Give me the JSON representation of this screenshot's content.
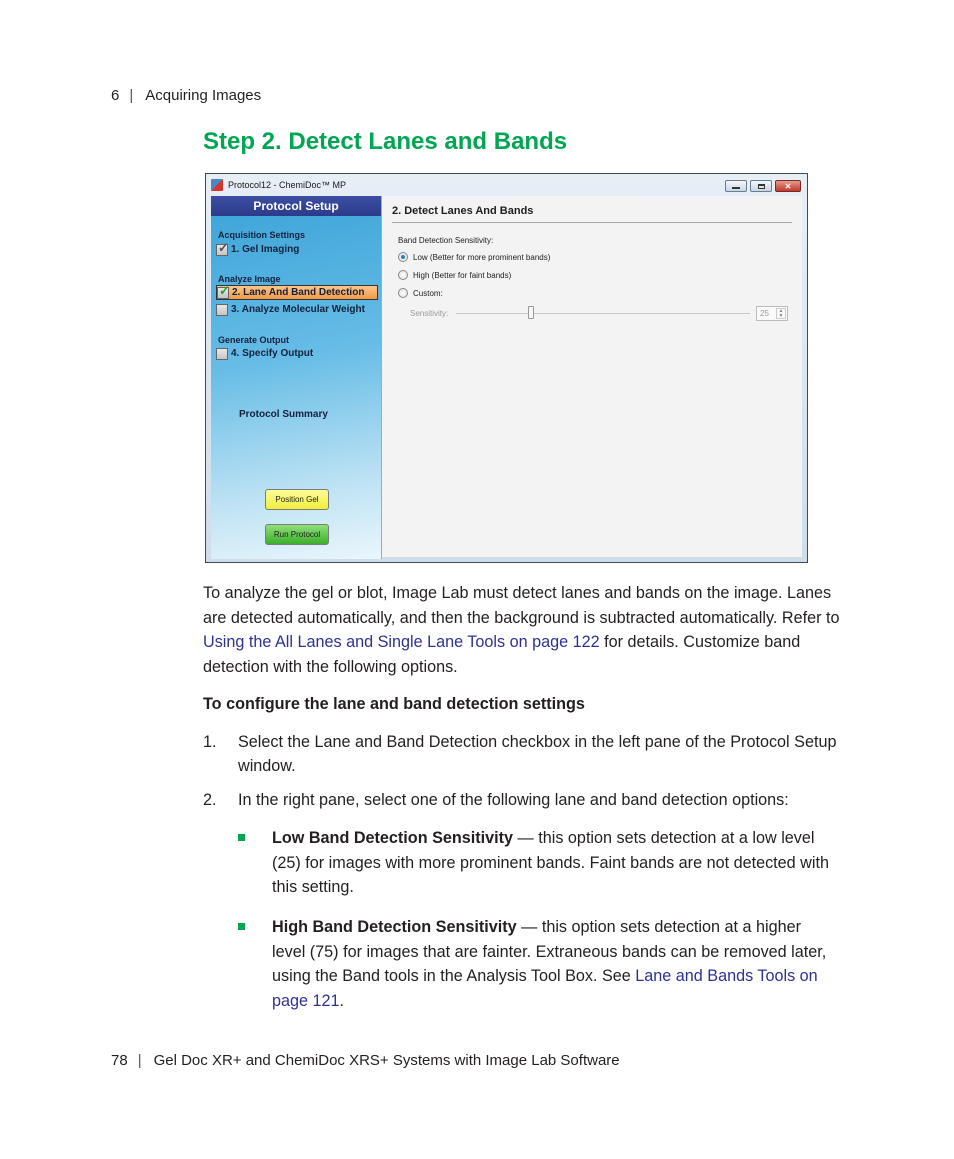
{
  "header": {
    "page_number": "6",
    "section": "Acquiring Images"
  },
  "title": "Step 2. Detect Lanes and Bands",
  "screenshot": {
    "window_title": "Protocol12 - ChemiDoc™ MP",
    "controls": {
      "minimize": "minimize",
      "maximize": "maximize",
      "close": "✕"
    },
    "sidebar": {
      "header": "Protocol Setup",
      "sections": [
        {
          "label": "Acquisition Settings",
          "items": [
            {
              "label": "1. Gel Imaging",
              "checked": true,
              "active": false
            }
          ]
        },
        {
          "label": "Analyze Image",
          "items": [
            {
              "label": "2. Lane And Band Detection",
              "checked": true,
              "active": true
            },
            {
              "label": "3. Analyze Molecular Weight",
              "checked": false,
              "active": false
            }
          ]
        },
        {
          "label": "Generate Output",
          "items": [
            {
              "label": "4. Specify Output",
              "checked": false,
              "active": false
            }
          ]
        }
      ],
      "summary": "Protocol Summary",
      "position_gel_button": "Position Gel",
      "run_protocol_button": "Run Protocol"
    },
    "content": {
      "title": "2. Detect Lanes And Bands",
      "sensitivity_label": "Band Detection Sensitivity:",
      "options": [
        {
          "label": "Low (Better for more prominent bands)",
          "selected": true
        },
        {
          "label": "High (Better for faint bands)",
          "selected": false
        },
        {
          "label": "Custom:",
          "selected": false
        }
      ],
      "slider_label": "Sensitivity:",
      "slider_value": "25",
      "slider_fraction": 0.25
    }
  },
  "intro": {
    "text_before": "To analyze the gel or blot, Image Lab must detect lanes and bands on the image. Lanes are detected automatically, and then the background is subtracted automatically. Refer to ",
    "link": "Using the All Lanes and Single Lane Tools on page 122",
    "text_after": " for details. Customize band detection with the following options."
  },
  "procedure_heading": "To configure the lane and band detection settings",
  "steps": [
    {
      "num": "1.",
      "text": "Select the Lane and Band Detection checkbox in the left pane of the Protocol Setup window."
    },
    {
      "num": "2.",
      "text": "In the right pane, select one of the following lane and band detection options:"
    }
  ],
  "bullets": [
    {
      "bold": "Low Band Detection Sensitivity",
      "text": " — this option sets detection at a low level (25) for images with more prominent bands. Faint bands are not detected with this setting.",
      "link": "",
      "tail": ""
    },
    {
      "bold": "High Band Detection Sensitivity",
      "text": " — this option sets detection at a higher level (75) for images that are fainter. Extraneous bands can be removed later, using the Band tools in the Analysis Tool Box. See ",
      "link": "Lane and Bands Tools on page 121",
      "tail": "."
    }
  ],
  "footer": {
    "page_number": "78",
    "text": "Gel Doc XR+ and ChemiDoc XRS+ Systems with Image Lab Software"
  },
  "colors": {
    "title_green": "#00a651",
    "link_blue": "#2e3192",
    "sidebar_header": "#2c3a8a",
    "active_item": "#f29a46"
  }
}
